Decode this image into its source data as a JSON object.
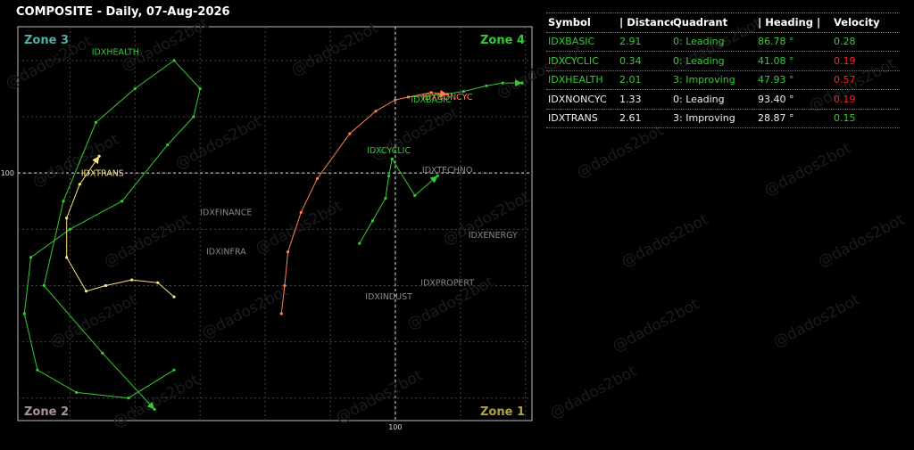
{
  "title": "COMPOSITE - Daily, 07-Aug-2026",
  "watermark": "@dados2bot",
  "colors": {
    "green": "#33cc33",
    "red": "#ff2020",
    "white": "#eeeeee",
    "grey": "#aaaaaa",
    "orange": "#ff7f50",
    "yellow": "#ffe680",
    "zone3": "#4fb0b0",
    "zone4": "#33cc33",
    "zone2": "#b09090",
    "zone1": "#b0a040"
  },
  "table": {
    "headers": {
      "symbol": "Symbol",
      "distance": "| Distance |",
      "quadrant": "Quadrant",
      "heading": "| Heading |",
      "velocity": "Velocity",
      "sep3": "|",
      "sep4": "|"
    },
    "rows": [
      {
        "symbol": "IDXBASIC",
        "distance": "2.91",
        "quadrant": "0: Leading",
        "heading": "86.78 °",
        "velocity": "0.28",
        "color": "#33cc33",
        "velocity_color": "#33cc33"
      },
      {
        "symbol": "IDXCYCLIC",
        "distance": "0.34",
        "quadrant": "0: Leading",
        "heading": "41.08 °",
        "velocity": "0.19",
        "color": "#33cc33",
        "velocity_color": "#ff2020"
      },
      {
        "symbol": "IDXHEALTH",
        "distance": "2.01",
        "quadrant": "3: Improving",
        "heading": "47.93 °",
        "velocity": "0.57",
        "color": "#33cc33",
        "velocity_color": "#ff2020"
      },
      {
        "symbol": "IDXNONCYC",
        "distance": "1.33",
        "quadrant": "0: Leading",
        "heading": "93.40 °",
        "velocity": "0.19",
        "color": "#eeeeee",
        "velocity_color": "#ff2020"
      },
      {
        "symbol": "IDXTRANS",
        "distance": "2.61",
        "quadrant": "3: Improving",
        "heading": "28.87 °",
        "velocity": "0.15",
        "color": "#eeeeee",
        "velocity_color": "#33cc33"
      }
    ]
  },
  "chart_data": {
    "type": "scatter",
    "title": "COMPOSITE - Daily, 07-Aug-2026",
    "xlim": [
      94.2,
      102.1
    ],
    "ylim": [
      95.6,
      102.6
    ],
    "center": [
      100,
      100
    ],
    "center_tick_labels": {
      "x": "100",
      "y": "100"
    },
    "grid": true,
    "zones": [
      {
        "name": "Zone 3",
        "position": "top-left",
        "color": "#4fb0b0"
      },
      {
        "name": "Zone 4",
        "position": "top-right",
        "color": "#33cc33"
      },
      {
        "name": "Zone 2",
        "position": "bottom-left",
        "color": "#b09090"
      },
      {
        "name": "Zone 1",
        "position": "bottom-right",
        "color": "#b0a040"
      }
    ],
    "series": [
      {
        "name": "IDXBASIC",
        "color": "#33cc33",
        "label_at": [
          100.55,
          101.25
        ],
        "x": [
          100.2,
          100.75,
          101.05,
          101.4,
          101.65,
          101.95
        ],
        "y": [
          101.35,
          101.4,
          101.45,
          101.55,
          101.6,
          101.6
        ]
      },
      {
        "name": "IDXCYCLIC",
        "color": "#33cc33",
        "label_at": [
          99.9,
          100.35
        ],
        "x": [
          99.45,
          99.65,
          99.85,
          99.9,
          99.95,
          100.3,
          100.65
        ],
        "y": [
          98.75,
          99.15,
          99.55,
          99.95,
          100.25,
          99.6,
          99.95
        ]
      },
      {
        "name": "IDXHEALTH",
        "color": "#33cc33",
        "label_at": [
          95.7,
          102.1
        ],
        "x": [
          96.6,
          95.9,
          95.1,
          94.5,
          94.3,
          94.4,
          95.0,
          95.8,
          96.5,
          96.9,
          97.0,
          96.6,
          96.0,
          95.4,
          94.9,
          94.6,
          95.5,
          96.3
        ],
        "y": [
          96.5,
          96.0,
          96.1,
          96.5,
          97.5,
          98.5,
          99.0,
          99.5,
          100.5,
          101.0,
          101.5,
          102.0,
          101.5,
          100.9,
          99.5,
          98.0,
          96.8,
          95.8
        ],
        "order": "older_to_newer_from_index_0",
        "render": "path_then_arrow_at_end"
      },
      {
        "name": "IDXNONCYC",
        "color": "#ff7f50",
        "label_at": [
          100.8,
          101.3
        ],
        "x": [
          98.25,
          98.3,
          98.35,
          98.55,
          98.8,
          99.3,
          99.7,
          100.0,
          100.2,
          100.55,
          100.8
        ],
        "y": [
          97.5,
          98.0,
          98.6,
          99.3,
          99.9,
          100.7,
          101.1,
          101.3,
          101.35,
          101.43,
          101.4
        ]
      },
      {
        "name": "IDXTRANS",
        "color": "#ffe680",
        "label_at": [
          95.5,
          99.95
        ],
        "x": [
          96.6,
          96.35,
          95.95,
          95.55,
          95.25,
          94.95,
          94.95,
          95.15,
          95.45
        ],
        "y": [
          97.8,
          98.05,
          98.1,
          98.0,
          97.9,
          98.5,
          99.2,
          99.8,
          100.3
        ]
      }
    ],
    "background_series": [
      {
        "name": "IDXTECHNO",
        "color": "#888888",
        "label_at": [
          100.8,
          100.0
        ]
      },
      {
        "name": "IDXFINANCE",
        "color": "#888888",
        "label_at": [
          97.4,
          99.25
        ]
      },
      {
        "name": "IDXINFRA",
        "color": "#888888",
        "label_at": [
          97.4,
          98.55
        ]
      },
      {
        "name": "IDXINDUST",
        "color": "#888888",
        "label_at": [
          99.9,
          97.75
        ]
      },
      {
        "name": "IDXPROPERT",
        "color": "#888888",
        "label_at": [
          100.8,
          98.0
        ]
      },
      {
        "name": "IDXENERGY",
        "color": "#888888",
        "label_at": [
          101.5,
          98.85
        ]
      }
    ]
  }
}
